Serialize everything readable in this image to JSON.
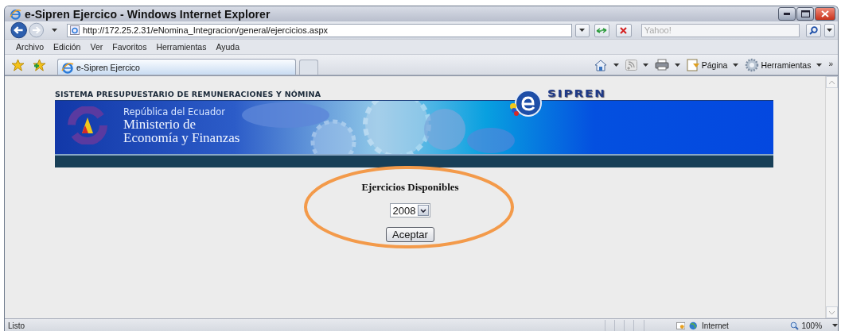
{
  "window": {
    "title": "e-Sipren Ejercico - Windows Internet Explorer"
  },
  "address_bar": {
    "url": "http://172.25.2.31/eNomina_Integracion/general/ejercicios.aspx"
  },
  "search": {
    "placeholder": "Yahoo!"
  },
  "menu": [
    "Archivo",
    "Edición",
    "Ver",
    "Favoritos",
    "Herramientas",
    "Ayuda"
  ],
  "tabs": [
    {
      "label": "e-Sipren Ejercico",
      "selected": true
    }
  ],
  "command_bar": [
    {
      "kind": "home"
    },
    {
      "kind": "feed"
    },
    {
      "kind": "print"
    },
    {
      "kind": "page",
      "label": "Página"
    },
    {
      "kind": "tools",
      "label": "Herramientas"
    }
  ],
  "command_overflow": "»",
  "page": {
    "header": "SISTEMA PRESUPUESTARIO DE REMUNERACIONES Y NÓMINA",
    "country": "República del Ecuador",
    "ministry": [
      "Ministerio de",
      "Economía y Finanzas"
    ],
    "logo": "SIPREN",
    "form_title": "Ejercicios Disponibles",
    "year": "2008",
    "button": "Aceptar"
  },
  "status_bar": {
    "text": "Listo",
    "zone": "Internet",
    "zoom": "100%"
  }
}
